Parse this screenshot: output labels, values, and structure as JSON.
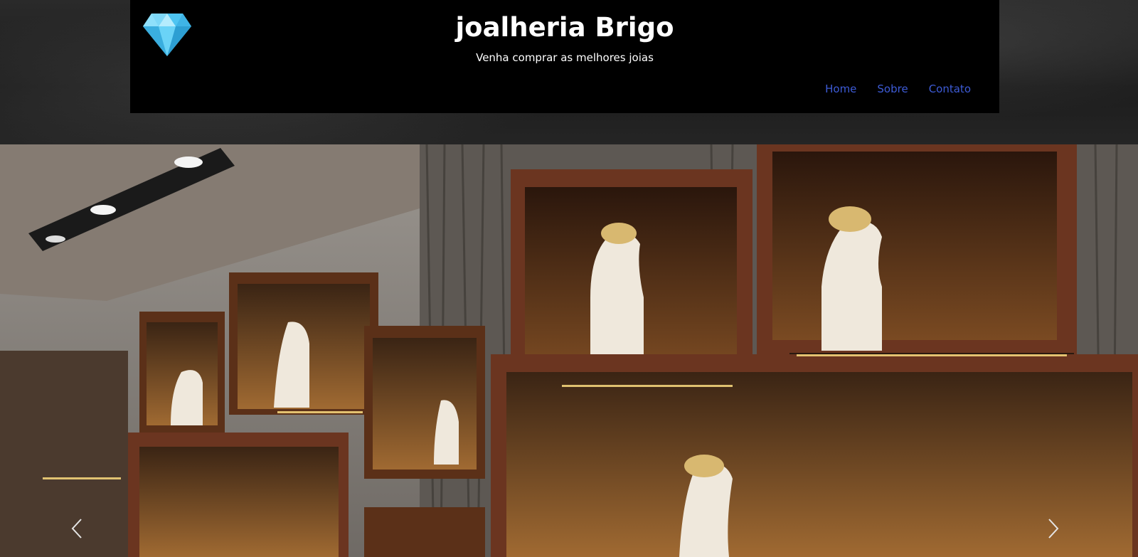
{
  "header": {
    "title": "joalheria Brigo",
    "subtitle": "Venha comprar as melhores joias",
    "logo_icon": "diamond-icon"
  },
  "nav": {
    "items": [
      {
        "label": "Home"
      },
      {
        "label": "Sobre"
      },
      {
        "label": "Contato"
      }
    ]
  },
  "carousel": {
    "prev_icon": "chevron-left-icon",
    "next_icon": "chevron-right-icon"
  },
  "colors": {
    "header_bg": "#000000",
    "nav_link": "#3d5bd6",
    "diamond": "#4fc3f7"
  }
}
